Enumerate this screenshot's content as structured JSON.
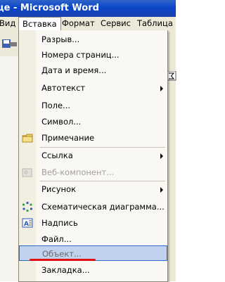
{
  "window": {
    "title": "це - Microsoft Word"
  },
  "menubar": {
    "items": [
      {
        "label": "Вид",
        "active": false
      },
      {
        "label": "Вставка",
        "active": true
      },
      {
        "label": "Формат",
        "active": false
      },
      {
        "label": "Сервис",
        "active": false
      },
      {
        "label": "Таблица",
        "active": false
      }
    ]
  },
  "menu": {
    "items": [
      {
        "label": "Разрыв...",
        "icon": null,
        "submenu": false,
        "disabled": false
      },
      {
        "label": "Номера страниц...",
        "icon": null,
        "submenu": false,
        "disabled": false
      },
      {
        "label": "Дата и время...",
        "icon": null,
        "submenu": false,
        "disabled": false
      },
      {
        "label": "Автотекст",
        "icon": null,
        "submenu": true,
        "disabled": false
      },
      {
        "label": "Поле...",
        "icon": null,
        "submenu": false,
        "disabled": false
      },
      {
        "label": "Символ...",
        "icon": null,
        "submenu": false,
        "disabled": false
      },
      {
        "label": "Примечание",
        "icon": "comment-icon",
        "submenu": false,
        "disabled": false
      },
      {
        "label": "Ссылка",
        "icon": null,
        "submenu": true,
        "disabled": false
      },
      {
        "label": "Веб-компонент...",
        "icon": "web-component-icon",
        "submenu": false,
        "disabled": true
      },
      {
        "label": "Рисунок",
        "icon": null,
        "submenu": true,
        "disabled": false
      },
      {
        "label": "Схематическая диаграмма...",
        "icon": "diagram-icon",
        "submenu": false,
        "disabled": false
      },
      {
        "label": "Надпись",
        "icon": "textbox-icon",
        "submenu": false,
        "disabled": false
      },
      {
        "label": "Файл...",
        "icon": null,
        "submenu": false,
        "disabled": false
      },
      {
        "label": "Объект...",
        "icon": null,
        "submenu": false,
        "disabled": false,
        "highlighted": true
      },
      {
        "label": "Закладка...",
        "icon": null,
        "submenu": false,
        "disabled": false
      }
    ]
  },
  "colors": {
    "highlight": "#c1d2ee",
    "highlight_border": "#316ac5",
    "annotation": "#e01010",
    "titlebar": "#0a46c9"
  }
}
